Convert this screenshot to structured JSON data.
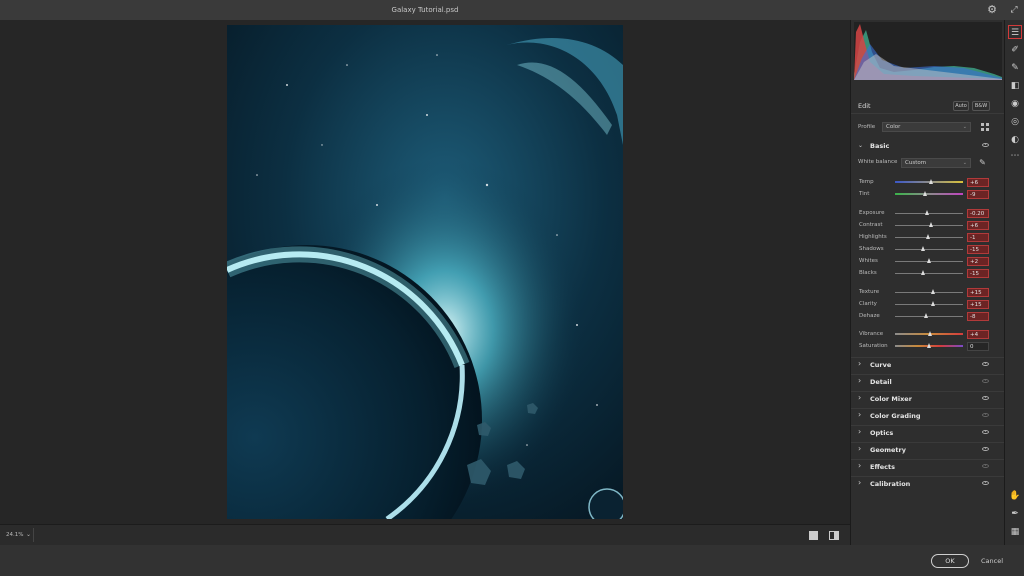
{
  "window": {
    "title": "Galaxy Tutorial.psd"
  },
  "canvas": {
    "zoom": "24.1%"
  },
  "panel": {
    "edit_label": "Edit",
    "auto_label": "Auto",
    "bw_label": "B&W",
    "profile_label": "Profile",
    "profile_value": "Color",
    "basic": {
      "title": "Basic",
      "white_balance_label": "White balance",
      "white_balance_value": "Custom",
      "sliders": [
        {
          "name": "Temp",
          "value": "+6",
          "pos": 0.54,
          "highlight": true,
          "track": "temp"
        },
        {
          "name": "Tint",
          "value": "-9",
          "pos": 0.45,
          "highlight": true,
          "track": "tint"
        },
        {
          "name": "Exposure",
          "value": "-0.20",
          "pos": 0.48,
          "highlight": true,
          "track": ""
        },
        {
          "name": "Contrast",
          "value": "+6",
          "pos": 0.53,
          "highlight": true,
          "track": ""
        },
        {
          "name": "Highlights",
          "value": "-1",
          "pos": 0.49,
          "highlight": true,
          "track": ""
        },
        {
          "name": "Shadows",
          "value": "-15",
          "pos": 0.42,
          "highlight": true,
          "track": ""
        },
        {
          "name": "Whites",
          "value": "+2",
          "pos": 0.51,
          "highlight": true,
          "track": ""
        },
        {
          "name": "Blacks",
          "value": "-15",
          "pos": 0.42,
          "highlight": true,
          "track": ""
        },
        {
          "name": "Texture",
          "value": "+15",
          "pos": 0.57,
          "highlight": true,
          "track": ""
        },
        {
          "name": "Clarity",
          "value": "+15",
          "pos": 0.57,
          "highlight": true,
          "track": ""
        },
        {
          "name": "Dehaze",
          "value": "-8",
          "pos": 0.46,
          "highlight": true,
          "track": ""
        },
        {
          "name": "Vibrance",
          "value": "+4",
          "pos": 0.52,
          "highlight": true,
          "track": "vib"
        },
        {
          "name": "Saturation",
          "value": "0",
          "pos": 0.5,
          "highlight": false,
          "track": "sat"
        }
      ]
    },
    "sections": [
      {
        "title": "Curve",
        "eye_visible": true
      },
      {
        "title": "Detail",
        "eye_visible": false
      },
      {
        "title": "Color Mixer",
        "eye_visible": true
      },
      {
        "title": "Color Grading",
        "eye_visible": false
      },
      {
        "title": "Optics",
        "eye_visible": true
      },
      {
        "title": "Geometry",
        "eye_visible": true
      },
      {
        "title": "Effects",
        "eye_visible": false
      },
      {
        "title": "Calibration",
        "eye_visible": true
      }
    ]
  },
  "footer": {
    "ok_label": "OK",
    "cancel_label": "Cancel"
  },
  "icons": {
    "settings": "gear-icon",
    "edit": "sliders-icon",
    "heal": "healing-brush-icon",
    "brush": "brush-icon",
    "gradient": "linear-gradient-icon",
    "radial": "radial-gradient-icon",
    "redeye": "red-eye-icon",
    "presets": "presets-icon",
    "more": "more-icon",
    "hand": "hand-icon",
    "sampler": "color-sampler-icon",
    "grid": "grid-icon"
  },
  "colors": {
    "accent_highlight": "#b13a3a",
    "panel_bg": "#2e2e2e"
  }
}
